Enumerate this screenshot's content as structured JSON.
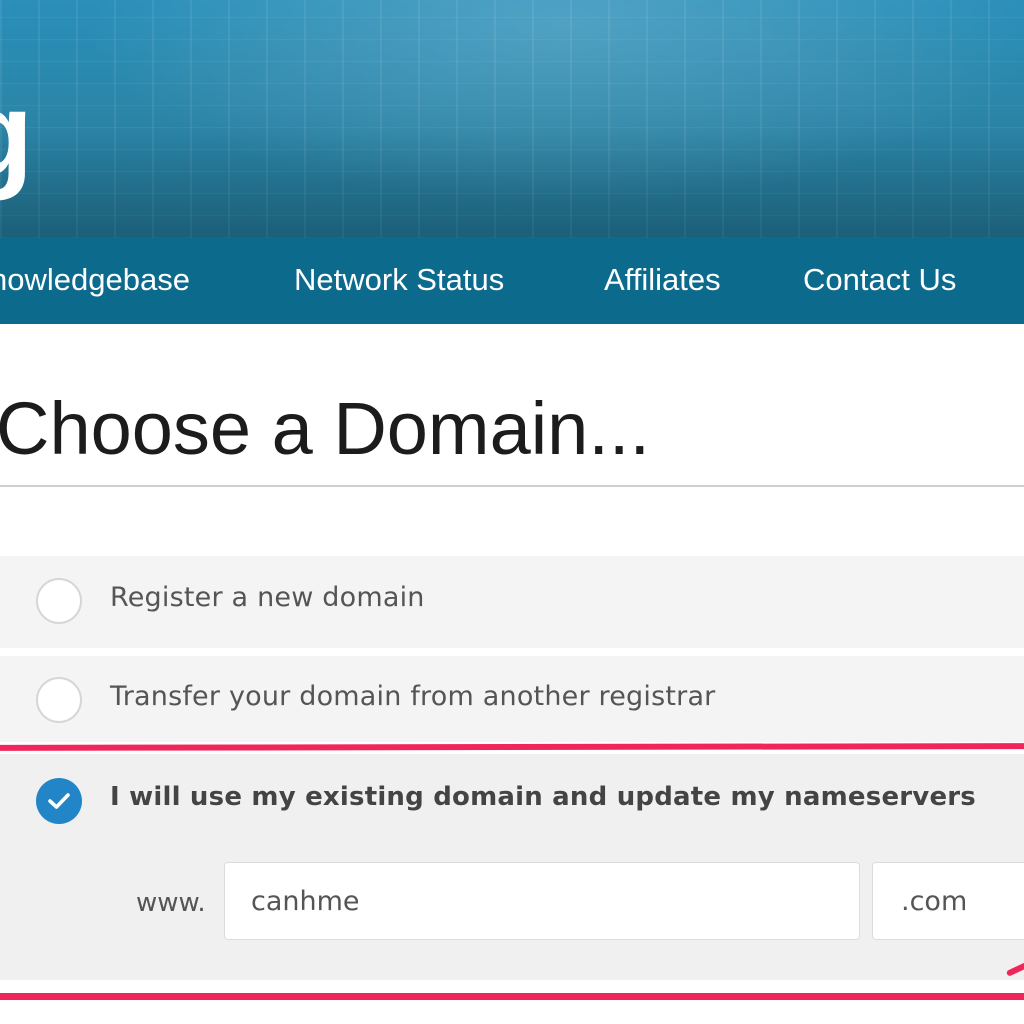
{
  "header": {
    "logo_fragment": "g"
  },
  "nav": {
    "items": [
      {
        "label": "nowledgebase"
      },
      {
        "label": "Network Status"
      },
      {
        "label": "Affiliates"
      },
      {
        "label": "Contact Us"
      }
    ]
  },
  "main": {
    "title": "Choose a Domain...",
    "options": [
      {
        "label": "Register a new domain",
        "selected": false
      },
      {
        "label": "Transfer your domain from another registrar",
        "selected": false
      },
      {
        "label": "I will use my existing domain and update my nameservers",
        "selected": true
      }
    ],
    "domain_form": {
      "prefix": "www.",
      "sld_value": "canhme",
      "tld_value": ".com"
    }
  },
  "colors": {
    "banner": "#2b86a9",
    "navbar": "#0c6a8c",
    "radio_checked": "#2185c8",
    "highlight": "#f0265a"
  },
  "icons": {
    "checked_radio": "check-icon"
  }
}
